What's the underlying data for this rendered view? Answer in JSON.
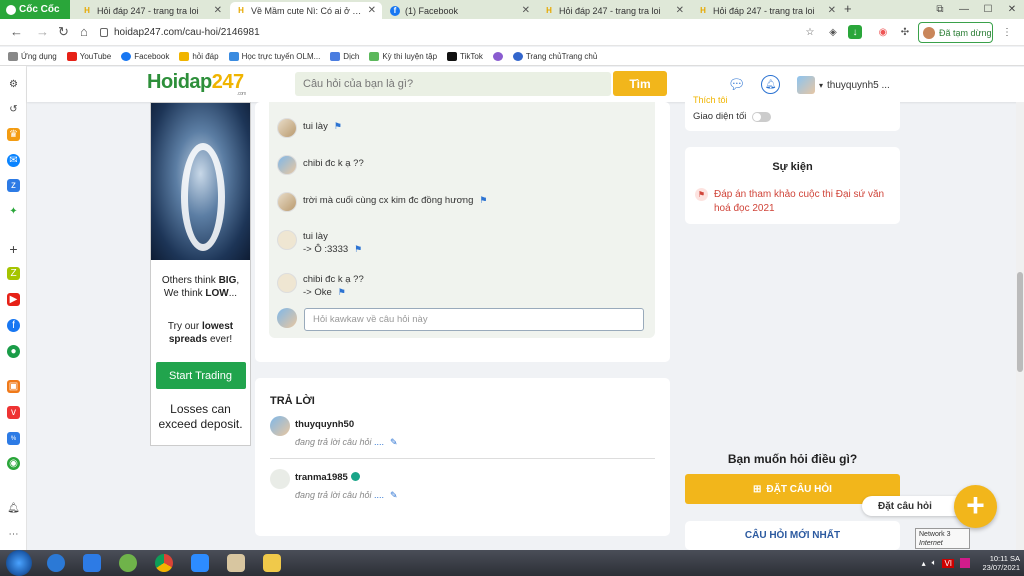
{
  "browser": {
    "brand": "Cốc Cốc",
    "tabs": [
      {
        "title": "Hỏi đáp 247 - trang tra loi",
        "favicon": "H",
        "active": false
      },
      {
        "title": "Về Mầm cute Nì: Có ai ở Trà",
        "favicon": "H",
        "active": true
      },
      {
        "title": "(1) Facebook",
        "favicon": "f",
        "active": false
      },
      {
        "title": "Hỏi đáp 247 - trang tra loi",
        "favicon": "H",
        "active": false
      },
      {
        "title": "Hỏi đáp 247 - trang tra loi",
        "favicon": "H",
        "active": false
      }
    ],
    "url": "hoidap247.com/cau-hoi/2146981",
    "paused_label": "Đã tạm dừng",
    "bookmarks": [
      "Ứng dụng",
      "YouTube",
      "Facebook",
      "hỏi đáp",
      "Học trực tuyến OLM...",
      "Dịch",
      "Kỳ thi luyện tập",
      "TikTok",
      "Trang chủTrang chủ"
    ]
  },
  "site": {
    "logo_main": "Hoidap",
    "logo_num": "247",
    "logo_small": ".com",
    "search_placeholder": "Câu hỏi của bạn là gì?",
    "search_button": "Tìm",
    "username": "thuyquynh5 ..."
  },
  "ad": {
    "line1a": "Others think ",
    "line1b": "BIG",
    "line1c": ",",
    "line2a": "We think ",
    "line2b": "LOW",
    "line2c": "...",
    "line3a": "Try our ",
    "line3b": "lowest",
    "line3c": "spreads",
    "line3d": " ever!",
    "cta": "Start Trading",
    "line4": "Losses can exceed deposit."
  },
  "comments": [
    {
      "text": "tui lày",
      "text2": ""
    },
    {
      "text": "chibi đc k ạ ??",
      "text2": ""
    },
    {
      "text": "trời mà cuối cùng cx kim đc đồng hương",
      "text2": ""
    },
    {
      "text": "tui lày",
      "text2": "-> Ô :3333"
    },
    {
      "text": "chibi đc k ạ ??",
      "text2": "-> Oke"
    }
  ],
  "reply_placeholder": "Hỏi kawkaw về câu hỏi này",
  "answers": {
    "heading": "TRẢ LỜI",
    "items": [
      {
        "name": "thuyquynh50",
        "status": "đang trả lời câu hỏi",
        "dots": "....",
        "verified": false
      },
      {
        "name": "tranma1985",
        "status": "đang trả lời câu hỏi",
        "dots": "....",
        "verified": true
      }
    ]
  },
  "right": {
    "thich": "Thích tôi",
    "dark_mode": "Giao diện tối",
    "event_title": "Sự kiện",
    "event_text": "Đáp án tham khảo cuộc thi Đại sứ văn hoá đọc 2021",
    "ask_question": "Bạn muốn hỏi điều gì?",
    "ask_button": "ĐẶT CÂU HỎI",
    "newest": "CÂU HỎI MỚI NHẤT",
    "fab_label": "Đặt câu hỏi"
  },
  "tooltip": {
    "line1": "Network 3",
    "line2": "Internet access"
  },
  "taskbar": {
    "lang": "VI",
    "time": "10:11 SA",
    "date": "23/07/2021"
  },
  "colors": {
    "brand_green": "#2d8f3a",
    "accent_yellow": "#f2b61b",
    "link_blue": "#2c73d2",
    "event_red": "#d0453a"
  }
}
